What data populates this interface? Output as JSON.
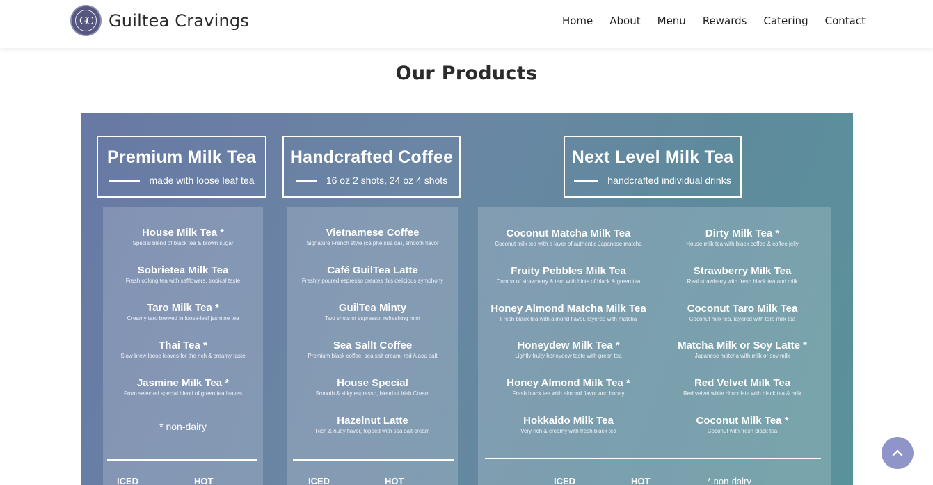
{
  "header": {
    "brand": "Guiltea Cravings",
    "nav": [
      "Home",
      "About",
      "Menu",
      "Rewards",
      "Catering",
      "Contact"
    ]
  },
  "page": {
    "title": "Our Products"
  },
  "menu": {
    "premium": {
      "title": "Premium Milk Tea",
      "subtitle": "made with loose leaf tea",
      "items": [
        {
          "name": "House Milk Tea *",
          "desc": "Special blend of black tea & brown sugar"
        },
        {
          "name": "Sobrietea Milk Tea",
          "desc": "Fresh oolong tea with safflowers, tropical taste"
        },
        {
          "name": "Taro Milk Tea *",
          "desc": "Creamy taro brewed in loose-leaf jasmine tea"
        },
        {
          "name": "Thai Tea *",
          "desc": "Slow brew loose leaves for the rich & creamy taste"
        },
        {
          "name": "Jasmine Milk Tea *",
          "desc": "From selected special blend of green tea leaves"
        }
      ],
      "note": "* non-dairy",
      "footer": [
        "ICED",
        "HOT"
      ]
    },
    "coffee": {
      "title": "Handcrafted Coffee",
      "subtitle": "16 oz 2 shots, 24 oz 4 shots",
      "items": [
        {
          "name": "Vietnamese Coffee",
          "desc": "Signature French style (cà phê sua dá), smooth flavor"
        },
        {
          "name": "Café GuilTea Latte",
          "desc": "Freshly poured espresso creates this delicious symphony"
        },
        {
          "name": "GuilTea Minty",
          "desc": "Two shots of espresso, refreshing mint"
        },
        {
          "name": "Sea Sallt Coffee",
          "desc": "Premium black coffee, sea salt cream, red Alaea salt"
        },
        {
          "name": "House Special",
          "desc": "Smooth & silky espresso, blend of Irish Cream"
        },
        {
          "name": "Hazelnut Latte",
          "desc": "Rich & nutty flavor, topped with sea salt cream"
        }
      ],
      "footer": [
        "ICED",
        "HOT"
      ]
    },
    "nextlevel": {
      "title": "Next Level Milk Tea",
      "subtitle": "handcrafted individual drinks",
      "left": [
        {
          "name": "Coconut Matcha Milk Tea",
          "desc": "Coconut milk tea with a layer of authentic Japanese matcha"
        },
        {
          "name": "Fruity Pebbles Milk Tea",
          "desc": "Combo of strawberry & taro with hints of black & green tea"
        },
        {
          "name": "Honey Almond Matcha Milk Tea",
          "desc": "Fresh black tea with almond flavor, layered with matcha"
        },
        {
          "name": "Honeydew Milk Tea *",
          "desc": "Lightly fruity honeydew taste with green tea"
        },
        {
          "name": "Honey Almond Milk Tea *",
          "desc": "Fresh black tea with almond flavor and honey"
        },
        {
          "name": "Hokkaido Milk Tea",
          "desc": "Very rich & creamy with fresh black tea"
        }
      ],
      "right": [
        {
          "name": "Dirty Milk Tea *",
          "desc": "House milk tea with black coffee & coffee jelly"
        },
        {
          "name": "Strawberry Milk Tea",
          "desc": "Real strawberry with fresh black tea and milk"
        },
        {
          "name": "Coconut Taro Milk Tea",
          "desc": "Coconut milk tea, layered with taro milk tea"
        },
        {
          "name": "Matcha Milk or Soy Latte *",
          "desc": "Japanese matcha with milk or soy milk"
        },
        {
          "name": "Red Velvet Milk Tea",
          "desc": "Red velvet white chocolate with black tea & milk"
        },
        {
          "name": "Coconut Milk Tea *",
          "desc": "Coconut with fresh black tea"
        }
      ],
      "footer": [
        "ICED",
        "HOT",
        "* non-dairy"
      ]
    }
  }
}
